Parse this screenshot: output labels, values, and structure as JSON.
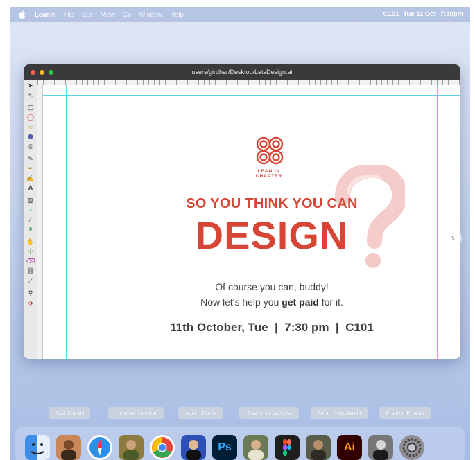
{
  "menubar": {
    "app": "LeanIn",
    "items": [
      "File",
      "Edit",
      "View",
      "Go",
      "Window",
      "Help"
    ],
    "room": "C101",
    "date": "Tue 11 Oct",
    "time": "7:30pm"
  },
  "window": {
    "title": "users/girdhar/Desktop/LetsDesign.ai",
    "traffic_colors": [
      "#ff5f57",
      "#febc2e",
      "#28c840"
    ]
  },
  "poster": {
    "logo_line1": "LEAN IN",
    "logo_line2": "CHAPTER",
    "headline_top": "SO YOU THINK YOU CAN",
    "headline_main": "DESIGN",
    "subline1": "Of course you can, buddy!",
    "subline2_pre": "Now let's help you ",
    "subline2_bold": "get paid",
    "subline2_post": " for it.",
    "event": "11th October, Tue  |  7:30 pm  |  C101",
    "accent": "#d64535"
  },
  "participants": [
    "Riya Sogani",
    "Hribhav Panchal",
    "Ayush Misra",
    "Sushmita Vavilala",
    "Aman Priyadarshi",
    "Prakhar Prasad"
  ],
  "dock": [
    "finder-icon",
    "person-avatar-icon",
    "safari-icon",
    "person-avatar-icon",
    "chrome-icon",
    "person-avatar-icon",
    "photoshop-icon",
    "person-avatar-icon",
    "figma-icon",
    "person-avatar-icon",
    "illustrator-icon",
    "person-avatar-icon",
    "system-preferences-icon"
  ],
  "dock_labels": {
    "photoshop": "Ps",
    "illustrator": "Ai"
  }
}
